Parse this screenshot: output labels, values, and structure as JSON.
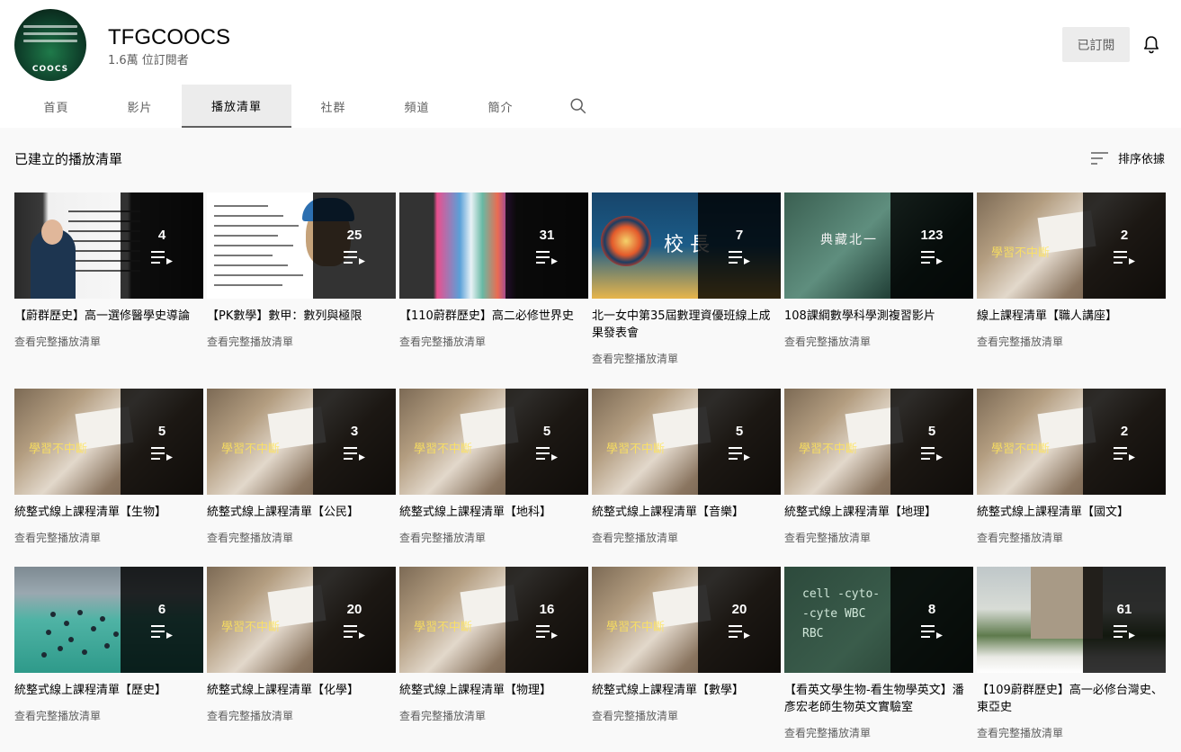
{
  "channel": {
    "name": "TFGCOOCS",
    "subscribers": "1.6萬 位訂閱者",
    "subscribe_label": "已訂閱",
    "avatar_text": "COOCS"
  },
  "tabs": [
    {
      "label": "首頁"
    },
    {
      "label": "影片"
    },
    {
      "label": "播放清單",
      "active": true
    },
    {
      "label": "社群"
    },
    {
      "label": "頻道"
    },
    {
      "label": "簡介"
    }
  ],
  "section": {
    "title": "已建立的播放清單",
    "sort_label": "排序依據"
  },
  "view_full_label": "查看完整播放清單",
  "playlists": [
    {
      "title": "【蔚群歷史】高一選修醫學史導論",
      "count": "4",
      "thumb": "lecture"
    },
    {
      "title": "【PK數學】數甲：數列與極限",
      "count": "25",
      "thumb": "math"
    },
    {
      "title": "【110蔚群歷史】高二必修世界史",
      "count": "31",
      "thumb": "art"
    },
    {
      "title": "北一女中第35屆數理資優班線上成果發表會",
      "count": "7",
      "thumb": "ceremony",
      "thumb_text": "校 長"
    },
    {
      "title": "108課綱數學科學測複習影片",
      "count": "123",
      "thumb": "green",
      "thumb_text": "典藏北一"
    },
    {
      "title": "線上課程清單【職人講座】",
      "count": "2",
      "thumb": "desk",
      "thumb_text": "學習不中斷"
    },
    {
      "title": "統整式線上課程清單【生物】",
      "count": "5",
      "thumb": "desk",
      "thumb_text": "學習不中斷"
    },
    {
      "title": "統整式線上課程清單【公民】",
      "count": "3",
      "thumb": "desk",
      "thumb_text": "學習不中斷"
    },
    {
      "title": "統整式線上課程清單【地科】",
      "count": "5",
      "thumb": "desk",
      "thumb_text": "學習不中斷"
    },
    {
      "title": "統整式線上課程清單【音樂】",
      "count": "5",
      "thumb": "desk",
      "thumb_text": "學習不中斷"
    },
    {
      "title": "統整式線上課程清單【地理】",
      "count": "5",
      "thumb": "desk",
      "thumb_text": "學習不中斷"
    },
    {
      "title": "統整式線上課程清單【國文】",
      "count": "2",
      "thumb": "desk",
      "thumb_text": "學習不中斷"
    },
    {
      "title": "統整式線上課程清單【歷史】",
      "count": "6",
      "thumb": "field"
    },
    {
      "title": "統整式線上課程清單【化學】",
      "count": "20",
      "thumb": "desk",
      "thumb_text": "學習不中斷"
    },
    {
      "title": "統整式線上課程清單【物理】",
      "count": "16",
      "thumb": "desk",
      "thumb_text": "學習不中斷"
    },
    {
      "title": "統整式線上課程清單【數學】",
      "count": "20",
      "thumb": "desk",
      "thumb_text": "學習不中斷"
    },
    {
      "title": "【看英文學生物-看生物學英文】潘彥宏老師生物英文實驗室",
      "count": "8",
      "thumb": "board",
      "thumb_text": "cell -cyto- -cyte WBC RBC"
    },
    {
      "title": "【109蔚群歷史】高一必修台灣史、東亞史",
      "count": "61",
      "thumb": "campus"
    }
  ],
  "colors": {
    "page_bg": "#f9f9f9",
    "header_bg": "#ffffff",
    "text_secondary": "#606060",
    "overlay": "rgba(0,0,0,0.8)"
  }
}
